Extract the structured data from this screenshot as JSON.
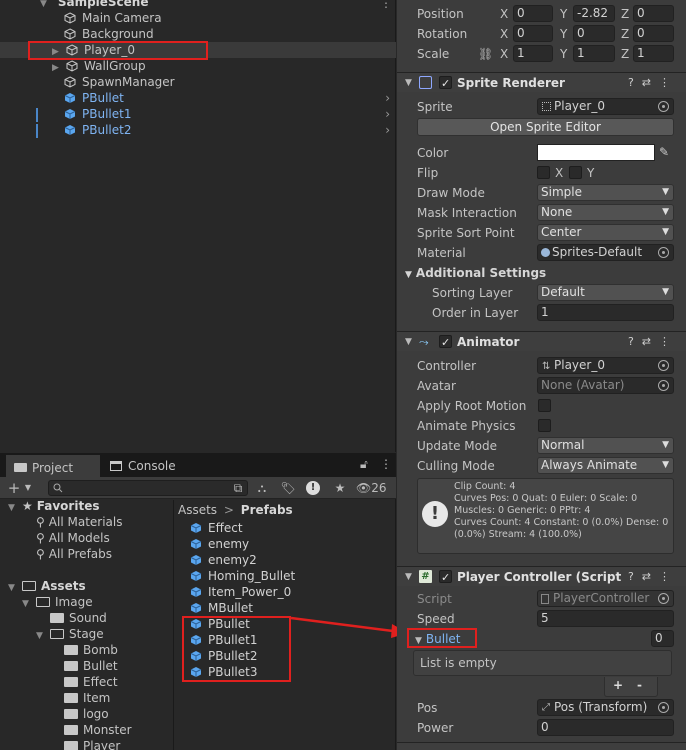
{
  "hierarchy": {
    "scene": "SampleScene",
    "items": [
      {
        "label": "Main Camera"
      },
      {
        "label": "Background"
      },
      {
        "label": "Player_0"
      },
      {
        "label": "WallGroup"
      },
      {
        "label": "SpawnManager"
      },
      {
        "label": "PBullet"
      },
      {
        "label": "PBullet1"
      },
      {
        "label": "PBullet2"
      }
    ]
  },
  "project": {
    "tabs": {
      "project": "Project",
      "console": "Console"
    },
    "visible_count": "26",
    "favorites": {
      "label": "Favorites",
      "items": [
        "All Materials",
        "All Models",
        "All Prefabs"
      ]
    },
    "assets": {
      "label": "Assets",
      "image": "Image",
      "sound": "Sound",
      "stage": "Stage",
      "stage_children": [
        "Bomb",
        "Bullet",
        "Effect",
        "Item",
        "logo",
        "Monster",
        "Player"
      ]
    },
    "breadcrumb": {
      "root": "Assets",
      "sep": ">",
      "current": "Prefabs"
    },
    "prefabs": [
      "Effect",
      "enemy",
      "enemy2",
      "Homing_Bullet",
      "Item_Power_0",
      "MBullet",
      "PBullet",
      "PBullet1",
      "PBullet2",
      "PBullet3"
    ]
  },
  "inspector": {
    "transform": {
      "position": {
        "label": "Position",
        "x": "0",
        "y": "-2.82",
        "z": "0"
      },
      "rotation": {
        "label": "Rotation",
        "x": "0",
        "y": "0",
        "z": "0"
      },
      "scale": {
        "label": "Scale",
        "x": "1",
        "y": "1",
        "z": "1"
      },
      "axis": {
        "x": "X",
        "y": "Y",
        "z": "Z"
      }
    },
    "sprite_renderer": {
      "title": "Sprite Renderer",
      "sprite_label": "Sprite",
      "sprite_value": "Player_0",
      "open_editor": "Open Sprite Editor",
      "color_label": "Color",
      "flip_label": "Flip",
      "flip_x": "X",
      "flip_y": "Y",
      "draw_mode_label": "Draw Mode",
      "draw_mode": "Simple",
      "mask_label": "Mask Interaction",
      "mask": "None",
      "sort_point_label": "Sprite Sort Point",
      "sort_point": "Center",
      "material_label": "Material",
      "material": "Sprites-Default",
      "additional": "Additional Settings",
      "sorting_layer_label": "Sorting Layer",
      "sorting_layer": "Default",
      "order_label": "Order in Layer",
      "order": "1"
    },
    "animator": {
      "title": "Animator",
      "controller_label": "Controller",
      "controller": "Player_0",
      "avatar_label": "Avatar",
      "avatar": "None (Avatar)",
      "root_motion_label": "Apply Root Motion",
      "animate_physics_label": "Animate Physics",
      "update_mode_label": "Update Mode",
      "update_mode": "Normal",
      "culling_label": "Culling Mode",
      "culling": "Always Animate",
      "info": [
        "Clip Count: 4",
        "Curves Pos: 0 Quat: 0 Euler: 0 Scale: 0",
        "Muscles: 0 Generic: 0 PPtr: 4",
        "Curves Count: 4 Constant: 0 (0.0%) Dense: 0",
        "(0.0%) Stream: 4 (100.0%)"
      ]
    },
    "player_controller": {
      "title": "Player Controller (Script",
      "script_label": "Script",
      "script": "PlayerController",
      "speed_label": "Speed",
      "speed": "5",
      "bullet_label": "Bullet",
      "bullet_count": "0",
      "empty": "List is empty",
      "plus": "+",
      "minus": "-",
      "pos_label": "Pos",
      "pos": "Pos (Transform)",
      "power_label": "Power",
      "power": "0"
    }
  },
  "colors": {
    "prefab_blue": "#7fb4f2",
    "highlight_red": "#e0201e",
    "panel": "#3c3c3c"
  }
}
